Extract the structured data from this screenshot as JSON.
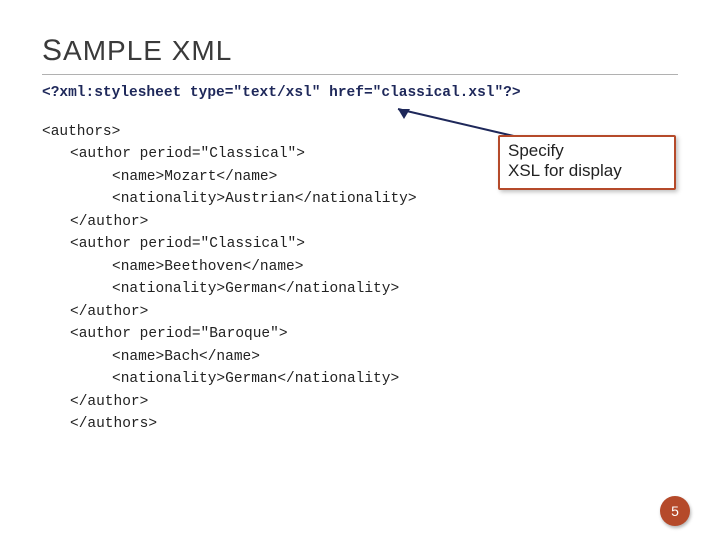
{
  "title": {
    "word1": "S",
    "word1b": "AMPLE",
    "word2": " XML"
  },
  "piLine": "<?xml:stylesheet type=\"text/xsl\" href=\"classical.xsl\"?>",
  "xmlLines": [
    {
      "cls": "",
      "text": "<authors>"
    },
    {
      "cls": "ind1",
      "text": "<author period=\"Classical\">"
    },
    {
      "cls": "ind2",
      "text": "<name>Mozart</name>"
    },
    {
      "cls": "ind2",
      "text": "<nationality>Austrian</nationality>"
    },
    {
      "cls": "ind1",
      "text": "</author>"
    },
    {
      "cls": "ind1",
      "text": "<author period=\"Classical\">"
    },
    {
      "cls": "ind2",
      "text": "<name>Beethoven</name>"
    },
    {
      "cls": "ind2",
      "text": "<nationality>German</nationality>"
    },
    {
      "cls": "ind1",
      "text": "</author>"
    },
    {
      "cls": "ind1",
      "text": "<author period=\"Baroque\">"
    },
    {
      "cls": "ind2",
      "text": "<name>Bach</name>"
    },
    {
      "cls": "ind2",
      "text": "<nationality>German</nationality>"
    },
    {
      "cls": "ind1",
      "text": "</author>"
    },
    {
      "cls": "ind1",
      "text": "</authors>"
    }
  ],
  "callout": {
    "line1": "Specify",
    "line2": "XSL for display"
  },
  "pageNumber": "5"
}
